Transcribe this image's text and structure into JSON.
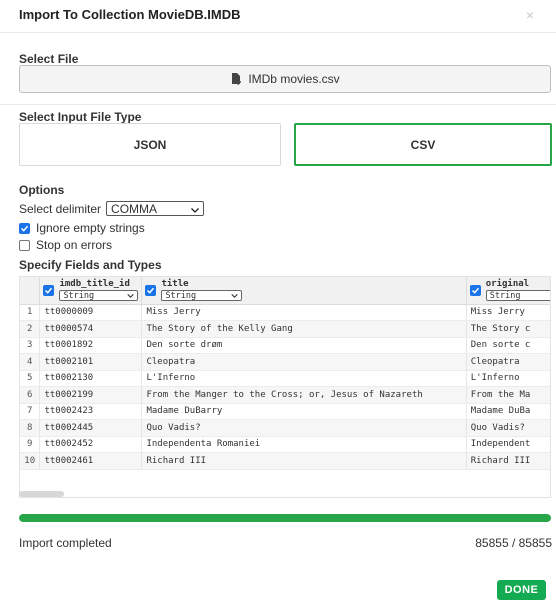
{
  "header": {
    "title": "Import To Collection MovieDB.IMDB",
    "close": "×"
  },
  "select_file": {
    "label": "Select File",
    "filename": "IMDb movies.csv"
  },
  "input_type": {
    "label": "Select Input File Type",
    "json": "JSON",
    "csv": "CSV",
    "selected": "CSV"
  },
  "options": {
    "label": "Options",
    "delimiter_label": "Select delimiter",
    "delimiter_value": "COMMA",
    "ignore_empty": {
      "label": "Ignore empty strings",
      "checked": true
    },
    "stop_errors": {
      "label": "Stop on errors",
      "checked": false
    }
  },
  "fields": {
    "label": "Specify Fields and Types",
    "columns": [
      {
        "name": "imdb_title_id",
        "type": "String",
        "checked": true
      },
      {
        "name": "title",
        "type": "String",
        "checked": true
      },
      {
        "name": "original",
        "type": "String",
        "checked": true
      }
    ],
    "rows": [
      [
        "1",
        "tt0000009",
        "Miss Jerry",
        "Miss Jerry"
      ],
      [
        "2",
        "tt0000574",
        "The Story of the Kelly Gang",
        "The Story c"
      ],
      [
        "3",
        "tt0001892",
        "Den sorte drøm",
        "Den sorte c"
      ],
      [
        "4",
        "tt0002101",
        "Cleopatra",
        "Cleopatra"
      ],
      [
        "5",
        "tt0002130",
        "L'Inferno",
        "L'Inferno"
      ],
      [
        "6",
        "tt0002199",
        "From the Manger to the Cross; or, Jesus of Nazareth",
        "From the Ma"
      ],
      [
        "7",
        "tt0002423",
        "Madame DuBarry",
        "Madame DuBa"
      ],
      [
        "8",
        "tt0002445",
        "Quo Vadis?",
        "Quo Vadis?"
      ],
      [
        "9",
        "tt0002452",
        "Independenta Romaniei",
        "Independent"
      ],
      [
        "10",
        "tt0002461",
        "Richard III",
        "Richard III"
      ]
    ]
  },
  "progress": {
    "fraction": 1.0,
    "status": "Import completed",
    "count": "85855 / 85855"
  },
  "done": "DONE",
  "colors": {
    "accent": "#27a549",
    "checkbox": "#1a73e8",
    "done": "#13aa52"
  }
}
